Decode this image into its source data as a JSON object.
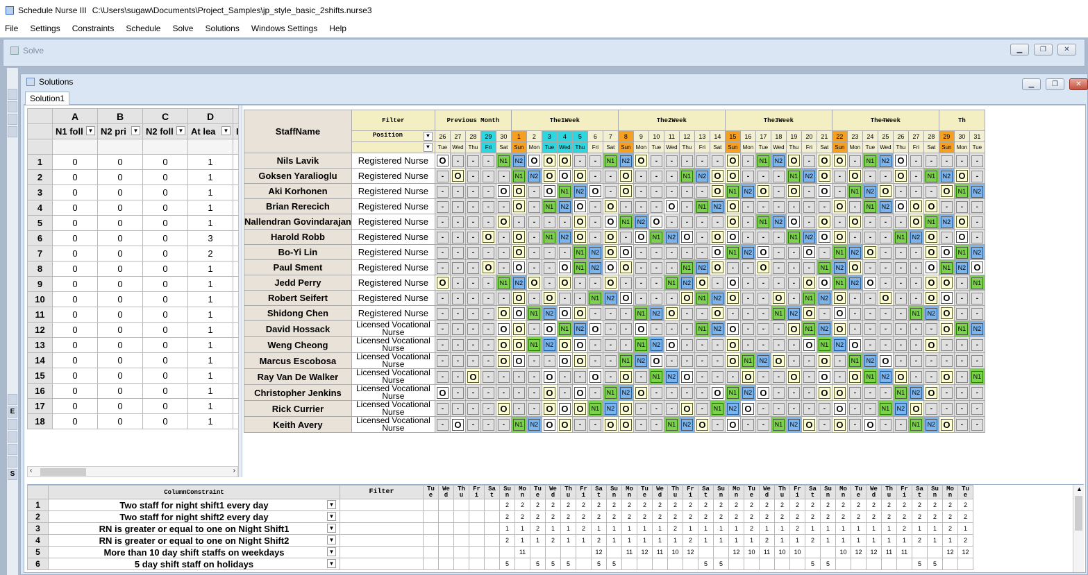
{
  "app": {
    "title": "Schedule Nurse III",
    "path": "C:\\Users\\sugaw\\Documents\\Project_Samples\\jp_style_basic_2shifts.nurse3"
  },
  "menu": [
    "File",
    "Settings",
    "Constraints",
    "Schedule",
    "Solve",
    "Solutions",
    "Windows Settings",
    "Help"
  ],
  "solve_window": {
    "title": "Solve"
  },
  "solutions_window": {
    "title": "Solutions",
    "tab": "Solution1"
  },
  "left_grid": {
    "columns": [
      "A",
      "B",
      "C",
      "D"
    ],
    "headers": [
      "N1 foll",
      "N2 pri",
      "N2 foll",
      "At lea"
    ],
    "rows": [
      [
        "0",
        "0",
        "0",
        "1"
      ],
      [
        "0",
        "0",
        "0",
        "1"
      ],
      [
        "0",
        "0",
        "0",
        "1"
      ],
      [
        "0",
        "0",
        "0",
        "1"
      ],
      [
        "0",
        "0",
        "0",
        "1"
      ],
      [
        "0",
        "0",
        "0",
        "3"
      ],
      [
        "0",
        "0",
        "0",
        "2"
      ],
      [
        "0",
        "0",
        "0",
        "1"
      ],
      [
        "0",
        "0",
        "0",
        "1"
      ],
      [
        "0",
        "0",
        "0",
        "1"
      ],
      [
        "0",
        "0",
        "0",
        "1"
      ],
      [
        "0",
        "0",
        "0",
        "1"
      ],
      [
        "0",
        "0",
        "0",
        "1"
      ],
      [
        "0",
        "0",
        "0",
        "1"
      ],
      [
        "0",
        "0",
        "0",
        "1"
      ],
      [
        "0",
        "0",
        "0",
        "1"
      ],
      [
        "0",
        "0",
        "0",
        "1"
      ],
      [
        "0",
        "0",
        "0",
        "1"
      ]
    ]
  },
  "schedule": {
    "staff_header": "StaffName",
    "filter_label": "Filter",
    "position_label": "Position",
    "groups": [
      {
        "label": "Previous Month",
        "span": 5
      },
      {
        "label": "The1Week",
        "span": 7
      },
      {
        "label": "The2Week",
        "span": 7
      },
      {
        "label": "The3Week",
        "span": 7
      },
      {
        "label": "The4Week",
        "span": 7
      },
      {
        "label": "Th",
        "span": 3
      }
    ],
    "days": [
      "26",
      "27",
      "28",
      "29",
      "30",
      "1",
      "2",
      "3",
      "4",
      "5",
      "6",
      "7",
      "8",
      "9",
      "10",
      "11",
      "12",
      "13",
      "14",
      "15",
      "16",
      "17",
      "18",
      "19",
      "20",
      "21",
      "22",
      "23",
      "24",
      "25",
      "26",
      "27",
      "28",
      "29",
      "30",
      "31"
    ],
    "dows": [
      "Tue",
      "Wed",
      "Thu",
      "Fri",
      "Sat",
      "Sun",
      "Mon",
      "Tue",
      "Wed",
      "Thu",
      "Fri",
      "Sat",
      "Sun",
      "Mon",
      "Tue",
      "Wed",
      "Thu",
      "Fri",
      "Sat",
      "Sun",
      "Mon",
      "Tue",
      "Wed",
      "Thu",
      "Fri",
      "Sat",
      "Sun",
      "Mon",
      "Tue",
      "Wed",
      "Thu",
      "Fri",
      "Sat",
      "Sun",
      "Mon",
      "Tue"
    ],
    "day_colors": [
      "",
      "",
      "",
      "#2ed6e0",
      "",
      "#f5a020",
      "",
      "#2ed6e0",
      "#2ed6e0",
      "#2ed6e0",
      "",
      "",
      "#f5a020",
      "",
      "",
      "",
      "",
      "",
      "",
      "#f5a020",
      "",
      "",
      "",
      "",
      "",
      "",
      "#f5a020",
      "",
      "",
      "",
      "",
      "",
      "",
      "#f5a020",
      "",
      ""
    ],
    "staff": [
      {
        "name": "Nils Lavik",
        "pos": "Registered Nurse",
        "s": "O---N1N2OOO--N1N2O----O-N1N2O-OO-N1N2O----"
      },
      {
        "name": "Goksen Yaralioglu",
        "pos": "Registered Nurse",
        "s": "-O---N1N2OOO---N1N2OO---N1N2O-O--O-N1N2O-"
      },
      {
        "name": "Aki Korhonen",
        "pos": "Registered Nurse",
        "s": "----OO-ON1N2O-O----O-N1N2O-O-N1N2O---ON1N2"
      }
    ],
    "grid": [
      [
        "O",
        "-",
        "-",
        "-",
        "N1",
        "N2",
        "O",
        "O",
        "O",
        "-",
        "-",
        "N1",
        "N2",
        "O",
        "-",
        "-",
        "-",
        "-",
        "-",
        "O",
        "-",
        "N1",
        "N2",
        "O",
        "-",
        "O",
        "O",
        "-",
        "N1",
        "N2",
        "O",
        "-",
        "-",
        "-",
        "-",
        "-"
      ],
      [
        "-",
        "O",
        "-",
        "-",
        "-",
        "N1",
        "N2",
        "O",
        "O",
        "O",
        "-",
        "-",
        "O",
        "-",
        "-",
        "-",
        "N1",
        "N2",
        "O",
        "O",
        "-",
        "-",
        "-",
        "N1",
        "N2",
        "O",
        "-",
        "O",
        "-",
        "-",
        "O",
        "-",
        "N1",
        "N2",
        "O",
        "-"
      ],
      [
        "-",
        "-",
        "-",
        "-",
        "O",
        "O",
        "-",
        "O",
        "N1",
        "N2",
        "O",
        "-",
        "O",
        "-",
        "-",
        "-",
        "-",
        "-",
        "O",
        "N1",
        "N2",
        "O",
        "-",
        "O",
        "-",
        "O",
        "-",
        "N1",
        "N2",
        "O",
        "-",
        "-",
        "-",
        "O",
        "N1",
        "N2"
      ],
      [
        "-",
        "-",
        "-",
        "-",
        "-",
        "O",
        "-",
        "N1",
        "N2",
        "O",
        "-",
        "O",
        "-",
        "-",
        "-",
        "O",
        "-",
        "N1",
        "N2",
        "O",
        "-",
        "-",
        "-",
        "-",
        "-",
        "-",
        "O",
        "-",
        "N1",
        "N2",
        "O",
        "O",
        "O",
        "-",
        "-",
        "-"
      ],
      [
        "-",
        "-",
        "-",
        "-",
        "O",
        "-",
        "-",
        "-",
        "-",
        "O",
        "-",
        "O",
        "N1",
        "N2",
        "O",
        "-",
        "-",
        "-",
        "-",
        "O",
        "-",
        "N1",
        "N2",
        "O",
        "-",
        "O",
        "-",
        "O",
        "-",
        "-",
        "-",
        "O",
        "N1",
        "N2",
        "O",
        "-"
      ],
      [
        "-",
        "-",
        "-",
        "O",
        "-",
        "O",
        "-",
        "N1",
        "N2",
        "O",
        "-",
        "O",
        "-",
        "O",
        "N1",
        "N2",
        "O",
        "-",
        "O",
        "O",
        "-",
        "-",
        "-",
        "N1",
        "N2",
        "O",
        "O",
        "-",
        "-",
        "-",
        "N1",
        "N2",
        "O",
        "-",
        "O",
        "-"
      ],
      [
        "-",
        "-",
        "-",
        "-",
        "-",
        "O",
        "-",
        "-",
        "-",
        "N1",
        "N2",
        "O",
        "O",
        "-",
        "-",
        "-",
        "-",
        "-",
        "O",
        "N1",
        "N2",
        "O",
        "-",
        "-",
        "O",
        "-",
        "N1",
        "N2",
        "O",
        "-",
        "-",
        "-",
        "O",
        "O",
        "N1",
        "N2"
      ],
      [
        "-",
        "-",
        "-",
        "O",
        "-",
        "O",
        "-",
        "-",
        "O",
        "N1",
        "N2",
        "O",
        "O",
        "-",
        "-",
        "-",
        "N1",
        "N2",
        "O",
        "-",
        "-",
        "O",
        "-",
        "-",
        "-",
        "N1",
        "N2",
        "O",
        "-",
        "-",
        "-",
        "-",
        "O",
        "N1",
        "N2",
        "O"
      ],
      [
        "O",
        "-",
        "-",
        "-",
        "N1",
        "N2",
        "O",
        "-",
        "O",
        "-",
        "-",
        "O",
        "-",
        "-",
        "-",
        "N1",
        "N2",
        "O",
        "-",
        "O",
        "-",
        "-",
        "-",
        "-",
        "O",
        "O",
        "N1",
        "N2",
        "O",
        "-",
        "-",
        "-",
        "O",
        "O",
        "-",
        "N1"
      ],
      [
        "-",
        "-",
        "-",
        "-",
        "-",
        "O",
        "-",
        "O",
        "-",
        "-",
        "N1",
        "N2",
        "O",
        "-",
        "-",
        "-",
        "O",
        "N1",
        "N2",
        "O",
        "-",
        "-",
        "O",
        "-",
        "N1",
        "N2",
        "O",
        "-",
        "-",
        "O",
        "-",
        "-",
        "O",
        "O",
        "-",
        "-"
      ],
      [
        "-",
        "-",
        "-",
        "-",
        "O",
        "O",
        "N1",
        "N2",
        "O",
        "O",
        "-",
        "-",
        "-",
        "N1",
        "N2",
        "O",
        "-",
        "-",
        "O",
        "-",
        "-",
        "-",
        "N1",
        "N2",
        "O",
        "-",
        "O",
        "-",
        "-",
        "-",
        "-",
        "N1",
        "N2",
        "O",
        "-",
        "-"
      ],
      [
        "-",
        "-",
        "-",
        "-",
        "O",
        "O",
        "-",
        "O",
        "N1",
        "N2",
        "O",
        "-",
        "-",
        "O",
        "-",
        "-",
        "-",
        "N1",
        "N2",
        "O",
        "-",
        "-",
        "-",
        "O",
        "N1",
        "N2",
        "O",
        "-",
        "-",
        "-",
        "-",
        "-",
        "-",
        "O",
        "N1",
        "N2"
      ],
      [
        "-",
        "-",
        "-",
        "-",
        "O",
        "O",
        "N1",
        "N2",
        "O",
        "O",
        "-",
        "-",
        "-",
        "N1",
        "N2",
        "O",
        "-",
        "-",
        "-",
        "O",
        "-",
        "-",
        "-",
        "-",
        "O",
        "N1",
        "N2",
        "O",
        "-",
        "-",
        "-",
        "-",
        "O",
        "-",
        "-",
        "-"
      ],
      [
        "-",
        "-",
        "-",
        "-",
        "O",
        "O",
        "-",
        "-",
        "O",
        "O",
        "-",
        "-",
        "N1",
        "N2",
        "O",
        "-",
        "-",
        "-",
        "-",
        "O",
        "N1",
        "N2",
        "O",
        "-",
        "-",
        "O",
        "-",
        "N1",
        "N2",
        "O",
        "-",
        "-",
        "-",
        "-",
        "-",
        "-"
      ],
      [
        "-",
        "-",
        "O",
        "-",
        "-",
        "-",
        "-",
        "O",
        "-",
        "-",
        "O",
        "-",
        "O",
        "-",
        "N1",
        "N2",
        "O",
        "-",
        "-",
        "-",
        "O",
        "-",
        "-",
        "O",
        "-",
        "O",
        "-",
        "O",
        "N1",
        "N2",
        "O",
        "-",
        "-",
        "O",
        "-",
        "N1"
      ],
      [
        "O",
        "-",
        "-",
        "-",
        "-",
        "-",
        "-",
        "O",
        "-",
        "O",
        "-",
        "N1",
        "N2",
        "O",
        "-",
        "-",
        "-",
        "-",
        "O",
        "N1",
        "N2",
        "O",
        "-",
        "-",
        "-",
        "O",
        "O",
        "-",
        "-",
        "-",
        "N1",
        "N2",
        "O",
        "-",
        "-",
        "-"
      ],
      [
        "-",
        "-",
        "-",
        "-",
        "O",
        "-",
        "-",
        "O",
        "O",
        "O",
        "N1",
        "N2",
        "O",
        "-",
        "-",
        "-",
        "O",
        "-",
        "N1",
        "N2",
        "O",
        "-",
        "-",
        "-",
        "-",
        "-",
        "O",
        "-",
        "-",
        "N1",
        "N2",
        "O",
        "-",
        "-",
        "-",
        "-"
      ],
      [
        "-",
        "O",
        "-",
        "-",
        "-",
        "N1",
        "N2",
        "O",
        "O",
        "-",
        "-",
        "O",
        "O",
        "-",
        "-",
        "N1",
        "N2",
        "O",
        "-",
        "O",
        "-",
        "-",
        "N1",
        "N2",
        "O",
        "-",
        "O",
        "-",
        "O",
        "-",
        "-",
        "N1",
        "N2",
        "O",
        "-",
        "-"
      ]
    ],
    "names": [
      "Nils Lavik",
      "Goksen Yaralioglu",
      "Aki Korhonen",
      "Brian Rerecich",
      "Nallendran Govindarajan",
      "Harold Robb",
      "Bo-Yi Lin",
      "Paul Sment",
      "Jedd Perry",
      "Robert Seifert",
      "Shidong Chen",
      "David Hossack",
      "Weng Cheong",
      "Marcus Escobosa",
      "Ray Van De Walker",
      "Christopher Jenkins",
      "Rick Currier",
      "Keith Avery"
    ],
    "positions": [
      "Registered Nurse",
      "Registered Nurse",
      "Registered Nurse",
      "Registered Nurse",
      "Registered Nurse",
      "Registered Nurse",
      "Registered Nurse",
      "Registered Nurse",
      "Registered Nurse",
      "Registered Nurse",
      "Registered Nurse",
      "Licensed Vocational Nurse",
      "Licensed Vocational Nurse",
      "Licensed Vocational Nurse",
      "Licensed Vocational Nurse",
      "Licensed Vocational Nurse",
      "Licensed Vocational Nurse",
      "Licensed Vocational Nurse"
    ]
  },
  "constraints": {
    "header": "ColumnConstraint",
    "filter": "Filter",
    "dows": [
      "Tu e",
      "We d",
      "Th u",
      "Fr i",
      "Sa t",
      "Su n",
      "Mo n",
      "Tu e",
      "We d",
      "Th u",
      "Fr i",
      "Sa t",
      "Su n",
      "Mo n",
      "Tu e",
      "We d",
      "Th u",
      "Fr i",
      "Sa t",
      "Su n",
      "Mo n",
      "Tu e",
      "We d",
      "Th u",
      "Fr i",
      "Sa t",
      "Su n",
      "Mo n",
      "Tu e",
      "We d",
      "Th u",
      "Fr i",
      "Sa t",
      "Su n",
      "Mo n",
      "Tu e"
    ],
    "rows": [
      {
        "label": "Two staff for night shift1 every day",
        "vals": [
          "",
          "",
          "",
          "",
          "",
          "2",
          "2",
          "2",
          "2",
          "2",
          "2",
          "2",
          "2",
          "2",
          "2",
          "2",
          "2",
          "2",
          "2",
          "2",
          "2",
          "2",
          "2",
          "2",
          "2",
          "2",
          "2",
          "2",
          "2",
          "2",
          "2",
          "2",
          "2",
          "2",
          "2",
          "2"
        ]
      },
      {
        "label": "Two staff for night shift2 every day",
        "vals": [
          "",
          "",
          "",
          "",
          "",
          "2",
          "2",
          "2",
          "2",
          "2",
          "2",
          "2",
          "2",
          "2",
          "2",
          "2",
          "2",
          "2",
          "2",
          "2",
          "2",
          "2",
          "2",
          "2",
          "2",
          "2",
          "2",
          "2",
          "2",
          "2",
          "2",
          "2",
          "2",
          "2",
          "2",
          "2"
        ]
      },
      {
        "label": "RN is greater or equal to one on Night Shift1",
        "vals": [
          "",
          "",
          "",
          "",
          "",
          "1",
          "1",
          "2",
          "1",
          "1",
          "2",
          "1",
          "1",
          "1",
          "1",
          "1",
          "2",
          "1",
          "1",
          "1",
          "1",
          "2",
          "1",
          "1",
          "2",
          "1",
          "1",
          "1",
          "1",
          "1",
          "1",
          "2",
          "1",
          "1",
          "2",
          "1"
        ]
      },
      {
        "label": "RN is greater or equal to one on Night Shift2",
        "vals": [
          "",
          "",
          "",
          "",
          "",
          "2",
          "1",
          "1",
          "2",
          "1",
          "1",
          "2",
          "1",
          "1",
          "1",
          "1",
          "1",
          "2",
          "1",
          "1",
          "1",
          "1",
          "2",
          "1",
          "1",
          "2",
          "1",
          "1",
          "1",
          "1",
          "1",
          "1",
          "2",
          "1",
          "1",
          "2"
        ]
      },
      {
        "label": "More than 10 day shift staffs on weekdays",
        "vals": [
          "",
          "",
          "",
          "",
          "",
          "",
          "11",
          "",
          "",
          "",
          "",
          "12",
          "",
          "11",
          "12",
          "11",
          "10",
          "12",
          "",
          "",
          "12",
          "10",
          "11",
          "10",
          "10",
          "",
          "",
          "10",
          "12",
          "12",
          "11",
          "11",
          "",
          "",
          "12",
          "12"
        ]
      },
      {
        "label": "5 day shift staff on holidays",
        "vals": [
          "",
          "",
          "",
          "",
          "",
          "5",
          "",
          "5",
          "5",
          "5",
          "",
          "5",
          "5",
          "",
          "",
          "",
          "",
          "",
          "5",
          "5",
          "",
          "",
          "",
          "",
          "",
          "5",
          "5",
          "",
          "",
          "",
          "",
          "",
          "5",
          "5",
          "",
          ""
        ]
      }
    ]
  },
  "left_strip": [
    "E",
    "S"
  ]
}
